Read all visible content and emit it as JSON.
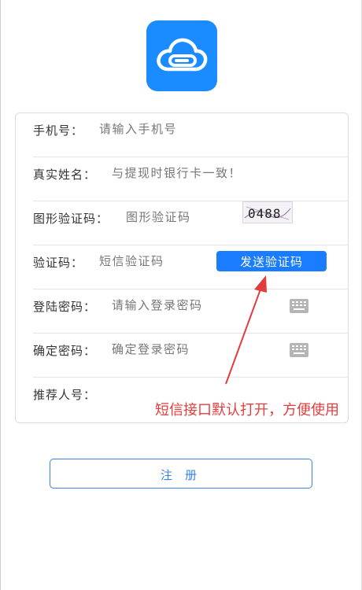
{
  "form": {
    "phone": {
      "label": "手机号：",
      "placeholder": "请输入手机号"
    },
    "real_name": {
      "label": "真实姓名：",
      "placeholder": "与提现时银行卡一致！"
    },
    "captcha": {
      "label": "图形验证码：",
      "placeholder": "图形验证码",
      "image_text": "0488"
    },
    "sms_code": {
      "label": "验证码：",
      "placeholder": "短信验证码",
      "send_button": "发送验证码"
    },
    "password": {
      "label": "登陆密码：",
      "placeholder": "请输入登录密码",
      "icon": "keyboard-icon"
    },
    "confirm_password": {
      "label": "确定密码：",
      "placeholder": "确定登录密码",
      "icon": "keyboard-icon"
    },
    "referrer": {
      "label": "推荐人号：",
      "placeholder": ""
    }
  },
  "annotation": {
    "text": "短信接口默认打开，方便使用",
    "color": "#e23d3d"
  },
  "register_button": {
    "label": "注册"
  },
  "colors": {
    "accent": "#1a7cff",
    "logo_bg": "#1a8cff",
    "annotation": "#e23d3d"
  }
}
